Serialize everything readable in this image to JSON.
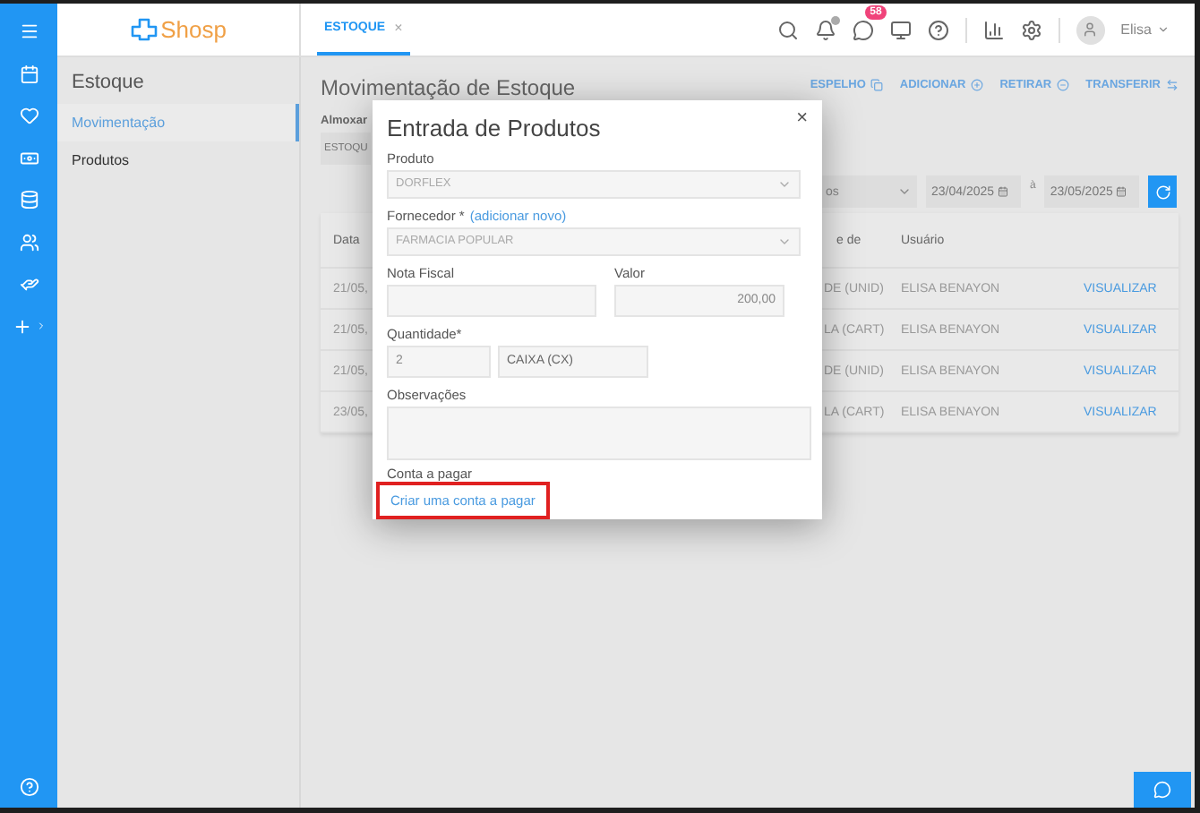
{
  "app": {
    "logo": "Shosp",
    "tabs": [
      {
        "label": "ESTOQUE",
        "close": "×",
        "selected": true
      }
    ],
    "chat_badge": "58",
    "user": "Elisa"
  },
  "sidebar": {
    "title": "Estoque",
    "items": [
      {
        "label": "Movimentação",
        "selected": true
      },
      {
        "label": "Produtos",
        "selected": false
      }
    ]
  },
  "page": {
    "title": "Movimentação de Estoque",
    "actions": [
      "ESPELHO",
      "ADICIONAR",
      "RETIRAR",
      "TRANSFERIR"
    ],
    "warehouse_label": "Almoxar",
    "warehouse_value": "ESTOQU",
    "filter_value": "os",
    "date_from": "23/04/2025",
    "date_sep": "à",
    "date_to": "23/05/2025"
  },
  "table": {
    "columns": [
      "Data",
      "",
      "e de",
      "Usuário",
      ""
    ],
    "rows": [
      {
        "date": "21/05,",
        "unit": "DE (UNID)",
        "user": "ELISA BENAYON",
        "action": "VISUALIZAR"
      },
      {
        "date": "21/05,",
        "unit": "LA (CART)",
        "user": "ELISA BENAYON",
        "action": "VISUALIZAR"
      },
      {
        "date": "21/05,",
        "unit": "DE (UNID)",
        "user": "ELISA BENAYON",
        "action": "VISUALIZAR"
      },
      {
        "date": "23/05,",
        "unit": "LA (CART)",
        "user": "ELISA BENAYON",
        "action": "VISUALIZAR"
      }
    ]
  },
  "modal": {
    "title": "Entrada de Produtos",
    "close": "×",
    "product_label": "Produto",
    "product_value": "DORFLEX",
    "supplier_label": "Fornecedor *",
    "supplier_link": "(adicionar novo)",
    "supplier_value": "FARMACIA POPULAR",
    "invoice_label": "Nota Fiscal",
    "value_label": "Valor",
    "value_value": "200,00",
    "quantity_label": "Quantidade*",
    "quantity_value": "2",
    "unit_value": "CAIXA (CX)",
    "notes_label": "Observações",
    "payable_label": "Conta a pagar",
    "payable_link": "Criar uma conta a pagar",
    "payable_link_highlighted": true
  }
}
